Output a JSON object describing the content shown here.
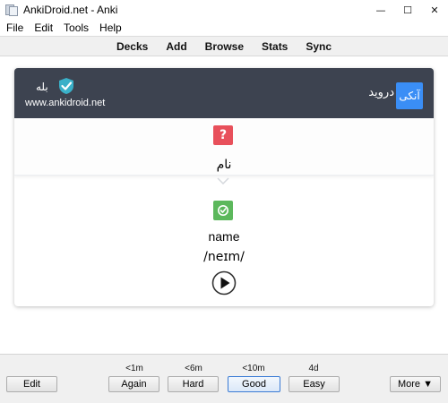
{
  "window": {
    "title": "AnkiDroid.net - Anki",
    "controls": {
      "minimize": "—",
      "maximize": "☐",
      "close": "✕"
    }
  },
  "menu": [
    "File",
    "Edit",
    "Tools",
    "Help"
  ],
  "toolbar": [
    "Decks",
    "Add",
    "Browse",
    "Stats",
    "Sync"
  ],
  "card": {
    "brand_title": "بله",
    "brand_url": "www.ankidroid.net",
    "banner_text": "درويد",
    "banner_badge": "آنکی",
    "front_badge": "?",
    "front_word": "نام",
    "answer_word": "name",
    "answer_ipa": "/neɪm/"
  },
  "answer_buttons": [
    {
      "label": "Again",
      "interval": "<1m"
    },
    {
      "label": "Hard",
      "interval": "<6m"
    },
    {
      "label": "Good",
      "interval": "<10m"
    },
    {
      "label": "Easy",
      "interval": "4d"
    }
  ],
  "edit_label": "Edit",
  "more_label": "More ▼",
  "colors": {
    "banner": "#3d4350",
    "badge_blue": "#3a8ef6",
    "question_red": "#e8505b",
    "answer_green": "#5cb85c"
  }
}
